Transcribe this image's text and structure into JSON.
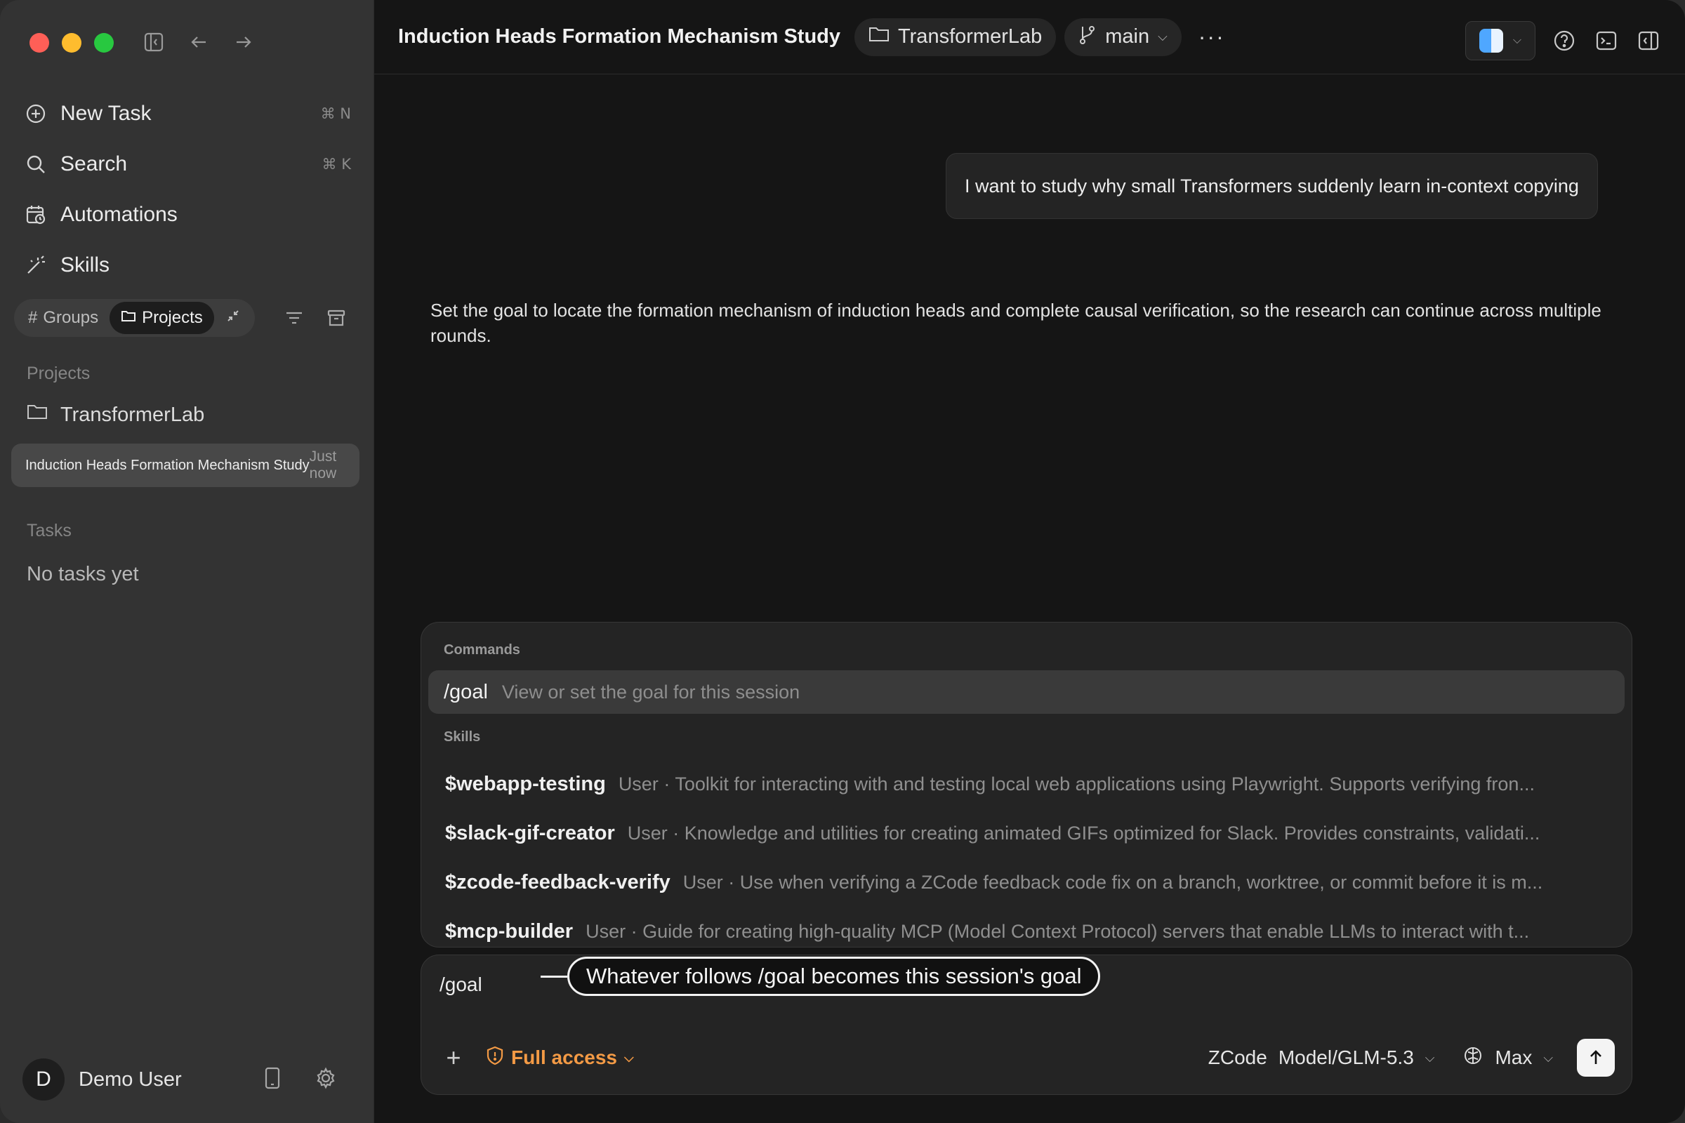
{
  "sidebar": {
    "nav": [
      {
        "label": "New Task",
        "shortcut": "⌘ N",
        "icon": "plus-circle-icon"
      },
      {
        "label": "Search",
        "shortcut": "⌘ K",
        "icon": "search-icon"
      },
      {
        "label": "Automations",
        "shortcut": "",
        "icon": "calendar-clock-icon"
      },
      {
        "label": "Skills",
        "shortcut": "",
        "icon": "magic-wand-icon"
      }
    ],
    "toggles": {
      "groups": "Groups",
      "projects": "Projects"
    },
    "projects_label": "Projects",
    "project_name": "TransformerLab",
    "task": {
      "title": "Induction Heads Formation Mechanism Study",
      "time": "Just now"
    },
    "tasks_label": "Tasks",
    "tasks_empty": "No tasks yet",
    "user": {
      "initial": "D",
      "name": "Demo User"
    }
  },
  "topbar": {
    "title": "Induction Heads Formation Mechanism Study",
    "project_chip": "TransformerLab",
    "branch_chip": "main",
    "more": "···"
  },
  "conversation": {
    "user_message": "I want to study why small Transformers suddenly learn in-context copying",
    "assistant_message": "Set the goal to locate the formation mechanism of induction heads and complete causal verification, so the research can continue across multiple rounds."
  },
  "palette": {
    "commands_header": "Commands",
    "command": {
      "name": "/goal",
      "desc": "View or set the goal for this session"
    },
    "skills_header": "Skills",
    "skills": [
      {
        "name": "$webapp-testing",
        "desc": "User · Toolkit for interacting with and testing local web applications using Playwright. Supports verifying fron..."
      },
      {
        "name": "$slack-gif-creator",
        "desc": "User · Knowledge and utilities for creating animated GIFs optimized for Slack. Provides constraints, validati..."
      },
      {
        "name": "$zcode-feedback-verify",
        "desc": "User · Use when verifying a ZCode feedback code fix on a branch, worktree, or commit before it is m..."
      },
      {
        "name": "$mcp-builder",
        "desc": "User · Guide for creating high-quality MCP (Model Context Protocol) servers that enable LLMs to interact with t..."
      }
    ]
  },
  "composer": {
    "input_value": "/goal",
    "callout": "Whatever follows /goal becomes this session's goal",
    "access": "Full access",
    "model_provider": "ZCode",
    "model": "Model/GLM-5.3",
    "effort": "Max"
  },
  "colors": {
    "accent_orange": "#f39a45",
    "traffic_red": "#fe5f57",
    "traffic_yellow": "#febc2e",
    "traffic_green": "#28c840"
  }
}
